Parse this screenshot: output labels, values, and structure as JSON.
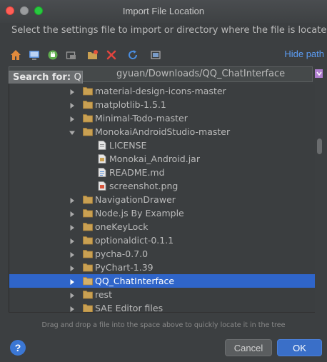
{
  "window": {
    "title": "Import File Location"
  },
  "instruction": "Select the settings file to import or directory where the file is located",
  "toolbar": {
    "icons": [
      "home-icon",
      "desktop-icon",
      "android-project-icon",
      "module-icon",
      "new-folder-icon",
      "delete-icon",
      "refresh-icon",
      "show-hidden-files-icon"
    ],
    "hide_path": "Hide path"
  },
  "path": {
    "value": "gyuan/Downloads/QQ_ChatInterface",
    "search_label": "Search for:",
    "search_query": "Q"
  },
  "tree": {
    "rows": [
      {
        "label": "material-design-icons-master",
        "type": "folder",
        "expanded": false
      },
      {
        "label": "matplotlib-1.5.1",
        "type": "folder",
        "expanded": false
      },
      {
        "label": "Minimal-Todo-master",
        "type": "folder",
        "expanded": false
      },
      {
        "label": "MonokaiAndroidStudio-master",
        "type": "folder",
        "expanded": true
      },
      {
        "label": "LICENSE",
        "type": "file-text"
      },
      {
        "label": "Monokai_Android.jar",
        "type": "file-jar"
      },
      {
        "label": "README.md",
        "type": "file-md"
      },
      {
        "label": "screenshot.png",
        "type": "file-image"
      },
      {
        "label": "NavigationDrawer",
        "type": "folder",
        "expanded": false
      },
      {
        "label": "Node.js By Example",
        "type": "folder",
        "expanded": false
      },
      {
        "label": "oneKeyLock",
        "type": "folder",
        "expanded": false
      },
      {
        "label": "optionaldict-0.1.1",
        "type": "folder",
        "expanded": false
      },
      {
        "label": "pycha-0.7.0",
        "type": "folder",
        "expanded": false
      },
      {
        "label": "PyChart-1.39",
        "type": "folder",
        "expanded": false
      },
      {
        "label": "QQ_ChatInterface",
        "type": "folder",
        "expanded": false,
        "selected": true
      },
      {
        "label": "rest",
        "type": "folder",
        "expanded": false
      },
      {
        "label": "SAE Editor files",
        "type": "folder",
        "expanded": false
      }
    ]
  },
  "hint": "Drag and drop a file into the space above to quickly locate it in the tree",
  "buttons": {
    "help": "?",
    "cancel": "Cancel",
    "ok": "OK"
  },
  "colors": {
    "selection": "#2f65ca",
    "link": "#5c9df5",
    "folder": "#c9a052",
    "ok": "#3a6fc8"
  }
}
